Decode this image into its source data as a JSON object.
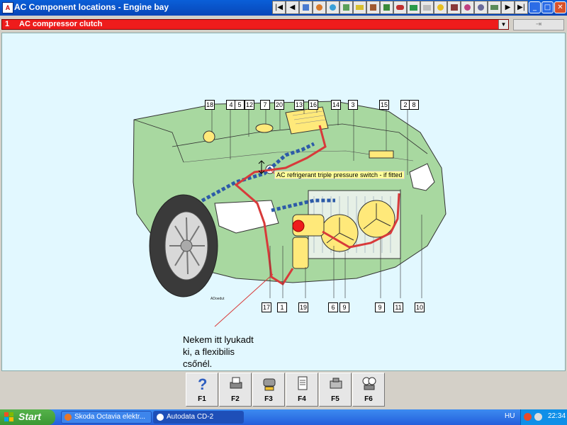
{
  "window": {
    "title": "AC Component locations - Engine bay"
  },
  "toolbar": {
    "nav_first": "|◀",
    "nav_prev": "◀",
    "nav_next": "▶",
    "nav_last": "▶|",
    "tools": [
      "hammer-icon",
      "paint-icon",
      "fan-icon",
      "dashboard-icon",
      "battery-icon",
      "tools-icon",
      "wrench-icon",
      "car-icon",
      "card-icon",
      "lightbulb-icon",
      "engine-icon",
      "gear-icon",
      "spark-icon",
      "tyre-icon",
      "tape-icon"
    ]
  },
  "window_buttons": {
    "minimize": "_",
    "maximize": "□",
    "close": "✕"
  },
  "component_select": {
    "number": "1",
    "label": "AC compressor clutch",
    "arrow": "▼"
  },
  "side_button": {
    "label": "⇥"
  },
  "diagram": {
    "callouts": [
      "18",
      "4",
      "5",
      "12",
      "7",
      "20",
      "13",
      "16",
      "14",
      "3",
      "15",
      "2",
      "8",
      "17",
      "1",
      "19",
      "6",
      "9",
      "9",
      "11",
      "10"
    ],
    "annotation": "AC refrigerant triple pressure switch - if fitted",
    "credit": "ADoedut"
  },
  "note": {
    "text": "Nekem itt lyukadt\nki, a flexibilis\ncsőnél."
  },
  "function_keys": [
    "F1",
    "F2",
    "F3",
    "F4",
    "F5",
    "F6"
  ],
  "taskbar": {
    "start": "Start",
    "tasks": [
      "Skoda Octavia elektr...",
      "Autodata CD-2"
    ],
    "language": "HU",
    "clock": "22:34"
  }
}
